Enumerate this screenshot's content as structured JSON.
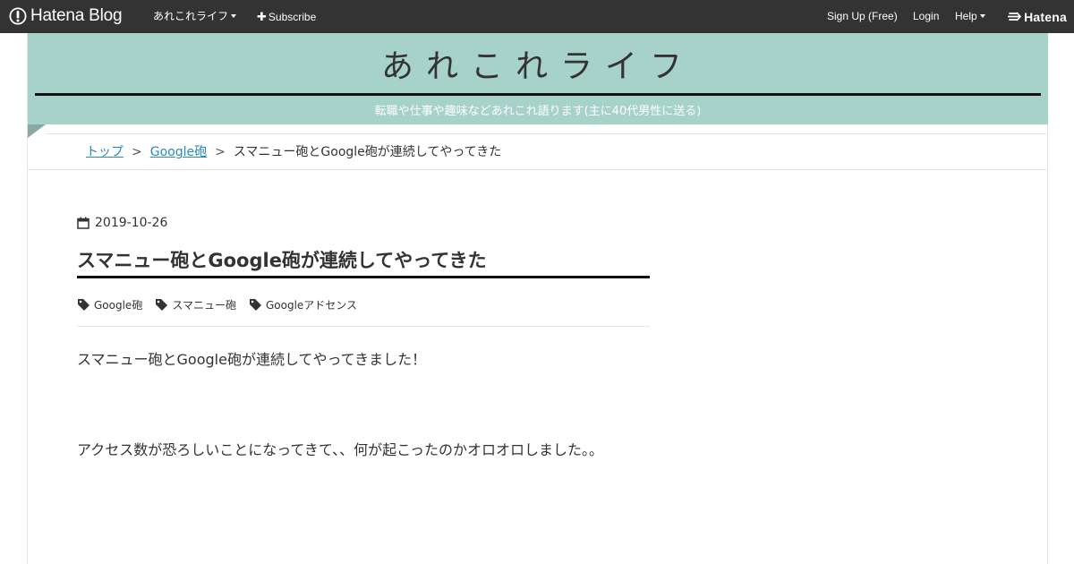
{
  "topbar": {
    "logo_text": "Hatena Blog",
    "blog_menu": "あれこれライフ",
    "subscribe": "Subscribe",
    "signup": "Sign Up (Free)",
    "login": "Login",
    "help": "Help",
    "hatena": "Hatena"
  },
  "header": {
    "title": "あれこれライフ",
    "description": "転職や仕事や趣味などあれこれ語ります(主に40代男性に送る)"
  },
  "breadcrumb": {
    "items": [
      {
        "label": "トップ"
      },
      {
        "label": "Google砲"
      }
    ],
    "current": "スマニュー砲とGoogle砲が連続してやってきた",
    "separator": ">"
  },
  "entry": {
    "date": "2019-10-26",
    "title": "スマニュー砲とGoogle砲が連続してやってきた",
    "tags": [
      "Google砲",
      "スマニュー砲",
      "Googleアドセンス"
    ],
    "paragraphs": [
      "スマニュー砲とGoogle砲が連続してやってきました！",
      "アクセス数が恐ろしいことになってきて、、何が起こったのかオロオロしました。。"
    ]
  },
  "colors": {
    "topbar_bg": "#333333",
    "header_bg": "#a6d2c9",
    "link": "#2a8ab7",
    "text": "#333333"
  },
  "icons": [
    "hatena-blog-logo-icon",
    "plus-icon",
    "hatena-logo-icon",
    "calendar-icon",
    "tag-icon"
  ]
}
